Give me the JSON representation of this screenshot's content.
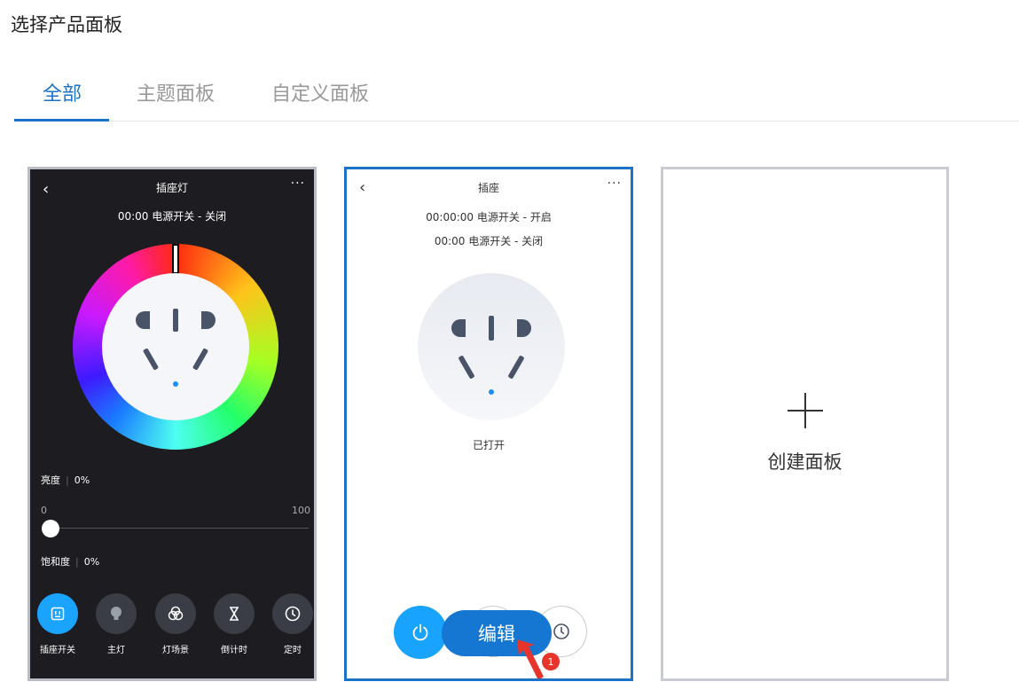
{
  "page": {
    "title": "选择产品面板"
  },
  "tabs": [
    {
      "label": "全部",
      "active": true
    },
    {
      "label": "主题面板",
      "active": false
    },
    {
      "label": "自定义面板",
      "active": false
    }
  ],
  "card_light_lamp": {
    "title": "插座灯",
    "timer": "00:00 电源开关 - 关闭",
    "brightness_label": "亮度",
    "brightness_value": "0%",
    "scale_min": "0",
    "scale_max": "100",
    "saturation_label": "饱和度",
    "saturation_value": "0%",
    "brightness_level": 0,
    "buttons": [
      {
        "label": "插座开关",
        "icon": "socket-icon",
        "active": true
      },
      {
        "label": "主灯",
        "icon": "bulb-icon",
        "active": false
      },
      {
        "label": "灯场景",
        "icon": "scene-icon",
        "active": false
      },
      {
        "label": "倒计时",
        "icon": "hourglass-icon",
        "active": false
      },
      {
        "label": "定时",
        "icon": "clock-icon",
        "active": false
      }
    ]
  },
  "card_socket": {
    "title": "插座",
    "timer_1": "00:00:00 电源开关 - 开启",
    "timer_2": "00:00 电源开关 - 关闭",
    "status": "已打开",
    "edit_label": "编辑",
    "badge": "1"
  },
  "card_create": {
    "label": "创建面板"
  },
  "colors": {
    "accent": "#1a73c8",
    "power_blue": "#18a3ff",
    "badge_red": "#e8352b",
    "dark_bg": "#1c1c21"
  }
}
